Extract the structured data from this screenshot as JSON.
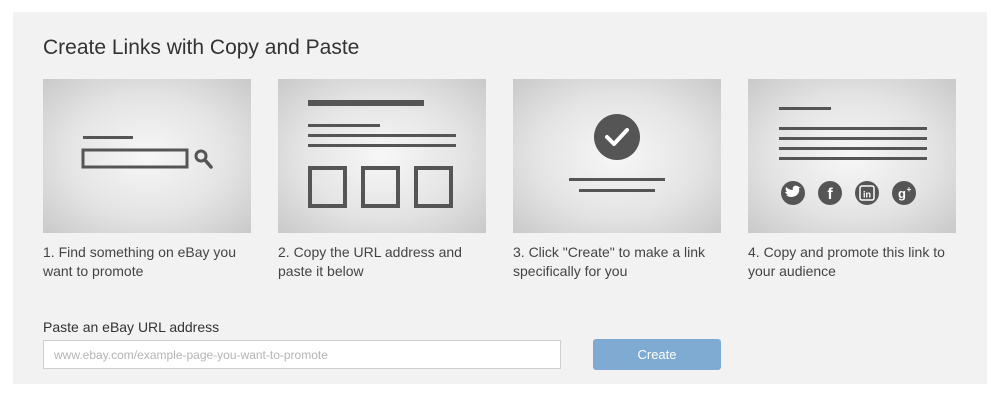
{
  "page": {
    "title": "Create Links with Copy and Paste"
  },
  "steps": [
    {
      "text": "1. Find something on eBay you want to promote",
      "icon": "search-bar-icon"
    },
    {
      "text": "2. Copy the URL address and paste it below",
      "icon": "document-layout-icon"
    },
    {
      "text": "3. Click \"Create\" to make a link specifically for you",
      "icon": "checkmark-icon"
    },
    {
      "text": "4. Copy and promote this link to your audience",
      "icon": "social-share-icon"
    }
  ],
  "form": {
    "label": "Paste an eBay URL address",
    "placeholder": "www.ebay.com/example-page-you-want-to-promote",
    "value": "",
    "button_label": "Create"
  },
  "colors": {
    "panel_bg": "#f2f2f2",
    "illustration_dark": "#555555",
    "button_bg": "#7fabd2",
    "button_text": "#ffffff"
  }
}
